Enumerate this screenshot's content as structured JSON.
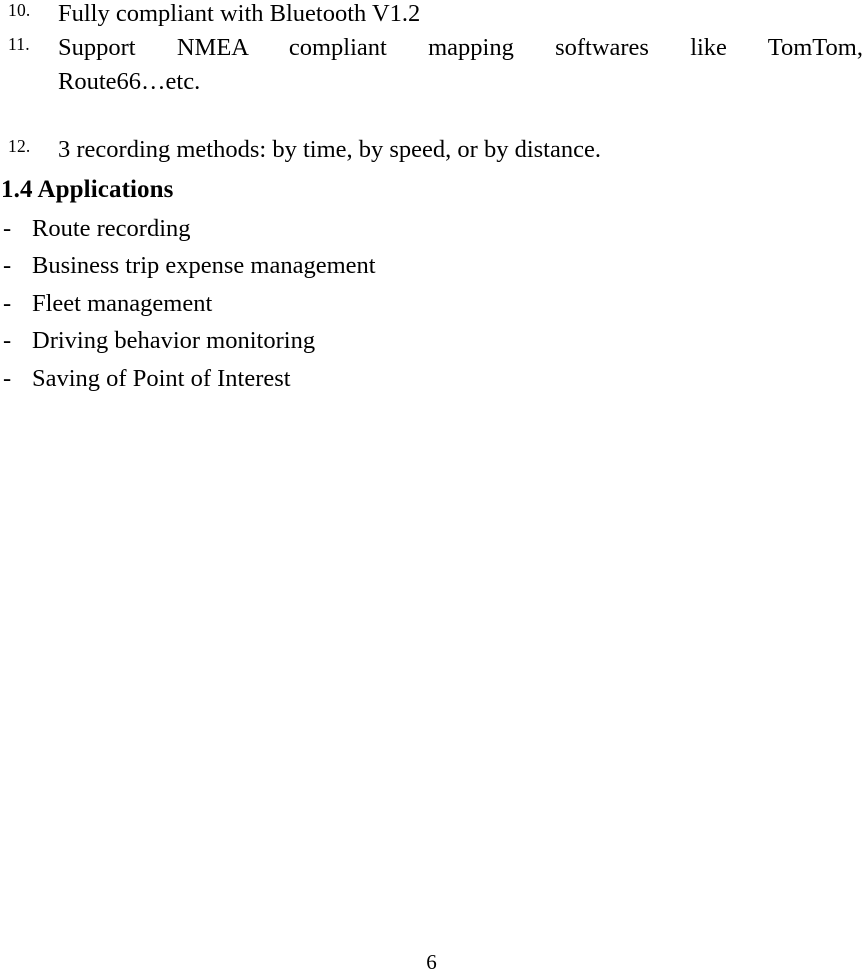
{
  "document": {
    "numbered_list": {
      "items": [
        {
          "marker": "10.",
          "text": "Fully compliant with Bluetooth V1.2",
          "justified": false,
          "lines": []
        },
        {
          "marker": "11.",
          "text": "Support NMEA compliant mapping softwares like TomTom, Route66…etc.",
          "justified": true,
          "lines": [
            "Support NMEA compliant mapping softwares like TomTom,",
            "Route66…etc."
          ]
        },
        {
          "marker": "12.",
          "text": "3 recording methods: by time, by speed, or by distance.",
          "justified": false,
          "lines": []
        }
      ]
    },
    "section": {
      "heading": "1.4 Applications",
      "bullet_marker": "-",
      "bullets": [
        "Route recording",
        "Business trip expense management",
        "Fleet management",
        "Driving behavior monitoring",
        "Saving of Point of Interest"
      ]
    },
    "footer": {
      "page_number": "6"
    }
  }
}
